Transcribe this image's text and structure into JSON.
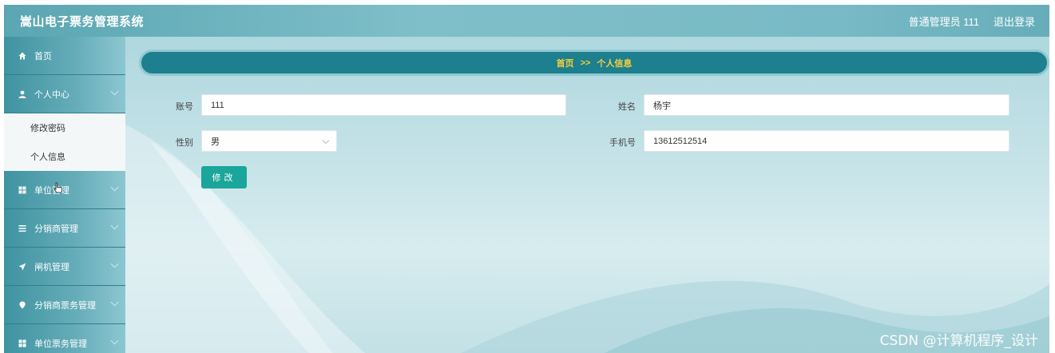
{
  "header": {
    "title": "嵩山电子票务管理系统",
    "user_label": "普通管理员 111",
    "logout_label": "退出登录"
  },
  "sidebar": {
    "items": [
      {
        "label": "首页",
        "icon": "home-icon"
      },
      {
        "label": "个人中心",
        "icon": "user-icon"
      },
      {
        "label": "单位管理",
        "icon": "grid-icon"
      },
      {
        "label": "分销商管理",
        "icon": "list-icon"
      },
      {
        "label": "闸机管理",
        "icon": "send-icon"
      },
      {
        "label": "分销商票务管理",
        "icon": "pin-icon"
      },
      {
        "label": "单位票务管理",
        "icon": "grid-icon"
      }
    ],
    "submenu": [
      "修改密码",
      "个人信息"
    ]
  },
  "breadcrumb": {
    "home": "首页",
    "separator": ">>",
    "current": "个人信息"
  },
  "form": {
    "account_label": "账号",
    "account_value": "111",
    "name_label": "姓名",
    "name_value": "杨宇",
    "gender_label": "性别",
    "gender_value": "男",
    "phone_label": "手机号",
    "phone_value": "13612512514",
    "submit_label": "修改"
  },
  "watermark": "CSDN @计算机程序_设计",
  "colors": {
    "accent": "#1aa69a",
    "breadcrumb_bg": "#1e7f8e",
    "breadcrumb_text": "#f4d13e",
    "sidebar": "#4f9eab"
  }
}
